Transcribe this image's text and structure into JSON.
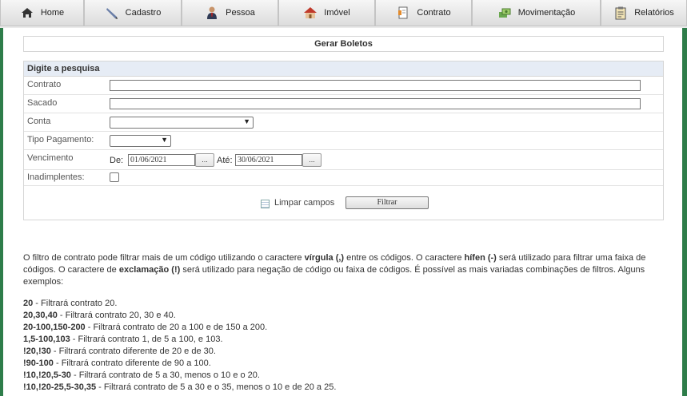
{
  "nav": [
    {
      "label": "Home",
      "icon": "home-icon"
    },
    {
      "label": "Cadastro",
      "icon": "pen-icon"
    },
    {
      "label": "Pessoa",
      "icon": "person-icon"
    },
    {
      "label": "Imóvel",
      "icon": "house-icon"
    },
    {
      "label": "Contrato",
      "icon": "contract-icon"
    },
    {
      "label": "Movimentação",
      "icon": "money-icon"
    },
    {
      "label": "Relatórios",
      "icon": "clipboard-icon"
    }
  ],
  "page_title": "Gerar Boletos",
  "form": {
    "header": "Digite a pesquisa",
    "contrato_label": "Contrato",
    "sacado_label": "Sacado",
    "conta_label": "Conta",
    "tipo_label": "Tipo Pagamento:",
    "vencimento_label": "Vencimento",
    "de_label": "De:",
    "de_value": "01/06/2021",
    "ate_label": "Até:",
    "ate_value": "30/06/2021",
    "dots": "...",
    "inadimplentes_label": "Inadimplentes:",
    "limpar_label": "Limpar campos",
    "filtrar_label": "Filtrar"
  },
  "help": {
    "p1_a": "O filtro de contrato pode filtrar mais de um código utilizando o caractere ",
    "p1_b": "vírgula (,)",
    "p1_c": " entre os códigos. O caractere ",
    "p1_d": "hífen (-)",
    "p1_e": " será utilizado para filtrar uma faixa de códigos. O caractere de ",
    "p1_f": "exclamação (!)",
    "p1_g": " será utilizado para negação de código ou faixa de códigos. É possível as mais variadas combinações de filtros. Alguns exemplos:",
    "examples": [
      {
        "code": "20",
        "text": " - Filtrará contrato 20."
      },
      {
        "code": "20,30,40",
        "text": " - Filtrará contrato 20, 30 e 40."
      },
      {
        "code": "20-100,150-200",
        "text": " - Filtrará contrato de 20 a 100 e de 150 a 200."
      },
      {
        "code": "1,5-100,103",
        "text": " - Filtrará contrato 1, de 5 a 100, e 103."
      },
      {
        "code": "!20,!30",
        "text": " - Filtrará contrato diferente de 20 e de 30."
      },
      {
        "code": "!90-100",
        "text": " - Filtrará contrato diferente de 90 a 100."
      },
      {
        "code": "!10,!20,5-30",
        "text": " - Filtrará contrato de 5 a 30, menos o 10 e o 20."
      },
      {
        "code": "!10,!20-25,5-30,35",
        "text": " - Filtrará contrato de 5 a 30 e o 35, menos o 10 e de 20 a 25."
      }
    ]
  }
}
